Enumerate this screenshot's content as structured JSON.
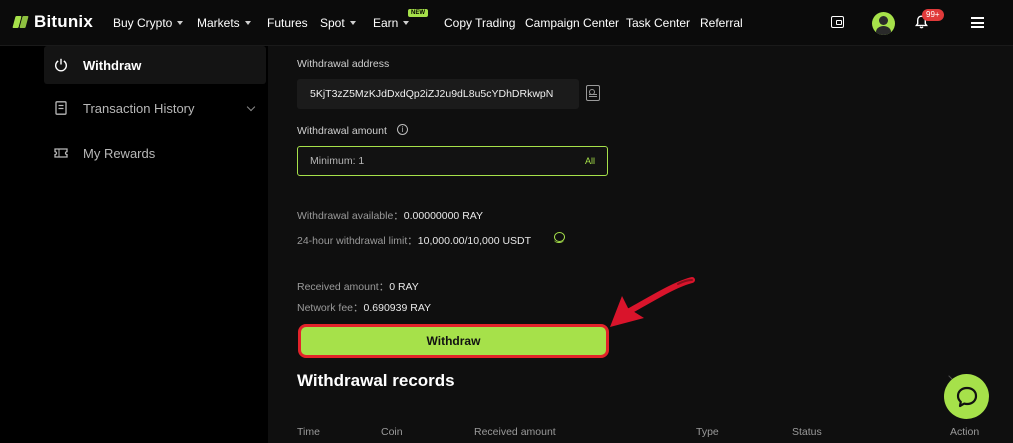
{
  "brand": {
    "name": "Bitunix",
    "accent": "#a6e14a"
  },
  "nav": {
    "items": [
      {
        "label": "Buy Crypto",
        "dropdown": true
      },
      {
        "label": "Markets",
        "dropdown": true
      },
      {
        "label": "Futures",
        "dropdown": false
      },
      {
        "label": "Spot",
        "dropdown": true
      },
      {
        "label": "Earn",
        "dropdown": true,
        "badge": "NEW"
      },
      {
        "label": "Copy Trading",
        "dropdown": false
      },
      {
        "label": "Campaign Center",
        "dropdown": false
      },
      {
        "label": "Task Center",
        "dropdown": false
      },
      {
        "label": "Referral",
        "dropdown": false
      }
    ],
    "notification_count": "99+",
    "icons": [
      "wallet-icon",
      "avatar",
      "bell-icon",
      "menu-icon"
    ]
  },
  "sidebar": {
    "items": [
      {
        "label": "Withdraw",
        "icon": "withdraw-icon",
        "active": true
      },
      {
        "label": "Transaction History",
        "icon": "document-icon",
        "expandable": true
      },
      {
        "label": "My Rewards",
        "icon": "ticket-icon"
      }
    ]
  },
  "withdraw": {
    "address_label": "Withdrawal address",
    "address_value": "5KjT3zZ5MzKJdDxdQp2iZJ2u9dL8u5cYDhDRkwpN",
    "amount_label": "Withdrawal amount",
    "amount_placeholder": "Minimum: 1",
    "all_label": "All",
    "available_label": "Withdrawal available：",
    "available_value": "0.00000000 RAY",
    "limit_label": "24-hour withdrawal limit：",
    "limit_value": "10,000.00/10,000 USDT",
    "received_label": "Received amount：",
    "received_value": "0 RAY",
    "fee_label": "Network fee：",
    "fee_value": "0.690939 RAY",
    "button_label": "Withdraw"
  },
  "records": {
    "title": "Withdrawal records",
    "columns": [
      "Time",
      "Coin",
      "Received amount",
      "Type",
      "Status",
      "Action"
    ]
  },
  "colors": {
    "highlight_border": "#e2232a",
    "annotation_arrow": "#d9142b"
  }
}
